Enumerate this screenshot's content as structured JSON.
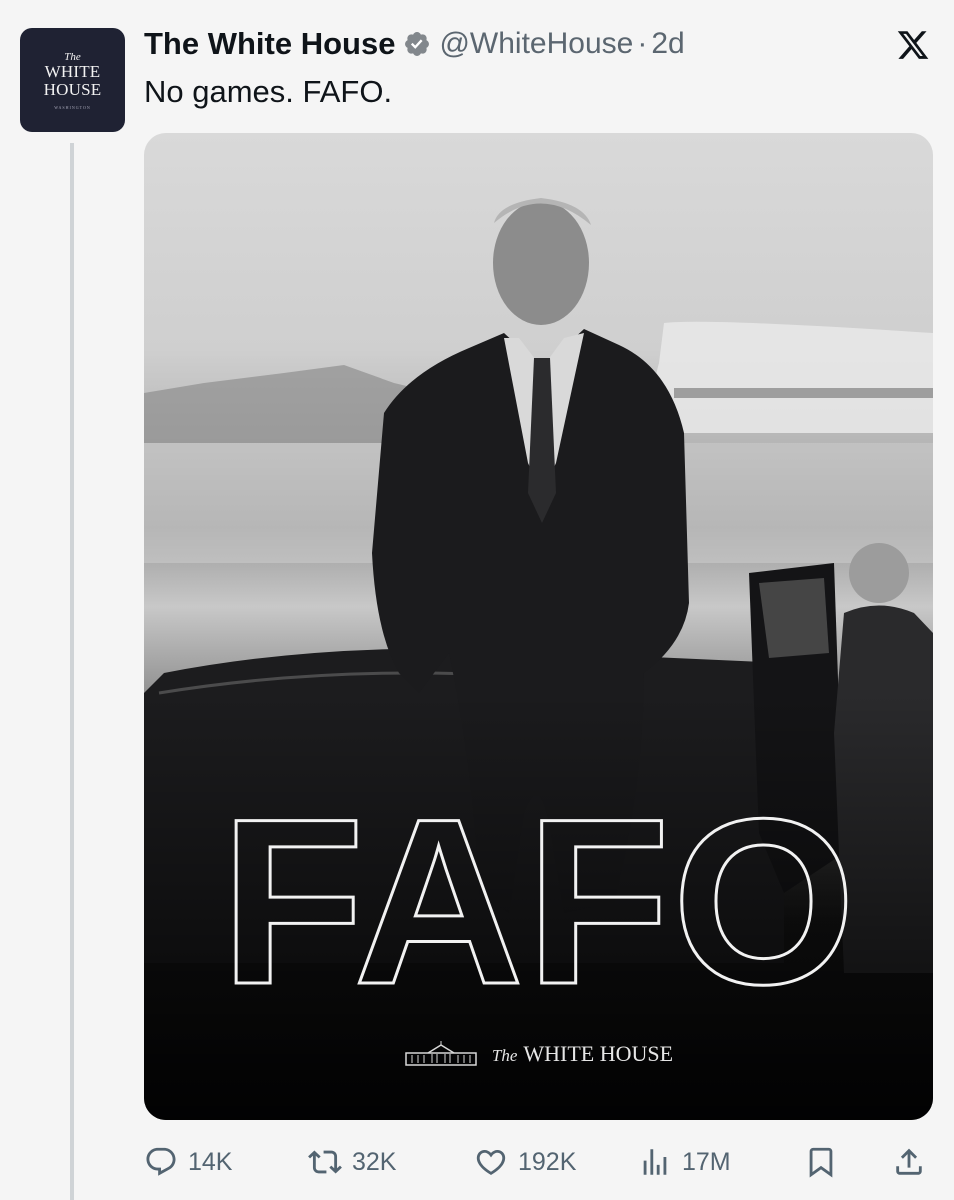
{
  "tweet": {
    "author": "The White House",
    "handle": "@WhiteHouse",
    "separator": "·",
    "time": "2d",
    "text": "No games. FAFO."
  },
  "avatar": {
    "line1": "The",
    "line2": "WHITE",
    "line3": "HOUSE",
    "line4": "WASHINGTON"
  },
  "media": {
    "overlay_text": "FAFO",
    "brand_the": "The",
    "brand_name": "WHITE HOUSE"
  },
  "actions": {
    "replies": "14K",
    "reposts": "32K",
    "likes": "192K",
    "views": "17M"
  },
  "icons": {
    "verified": "verified-badge-icon",
    "x_logo": "x-logo-icon",
    "reply": "reply-icon",
    "repost": "repost-icon",
    "like": "heart-icon",
    "views": "views-icon",
    "bookmark": "bookmark-icon",
    "share": "share-icon"
  },
  "colors": {
    "background": "#f5f5f5",
    "text": "#0f1419",
    "muted": "#536471",
    "avatar_bg": "#1f2233"
  }
}
